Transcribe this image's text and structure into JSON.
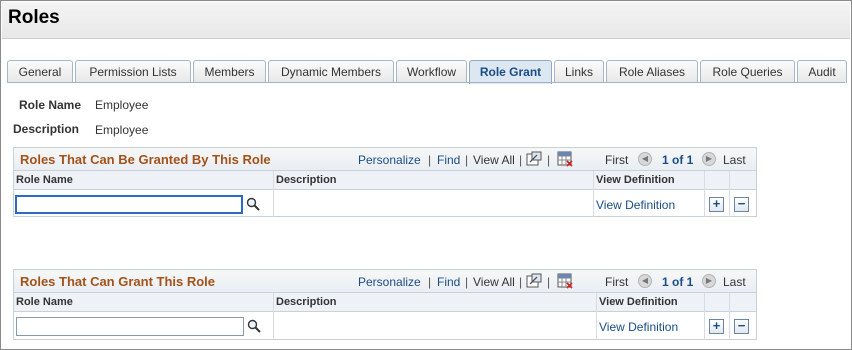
{
  "page": {
    "title": "Roles"
  },
  "tabs": [
    {
      "label": "General",
      "active": false
    },
    {
      "label": "Permission Lists",
      "active": false
    },
    {
      "label": "Members",
      "active": false
    },
    {
      "label": "Dynamic Members",
      "active": false
    },
    {
      "label": "Workflow",
      "active": false
    },
    {
      "label": "Role Grant",
      "active": true
    },
    {
      "label": "Links",
      "active": false
    },
    {
      "label": "Role Aliases",
      "active": false
    },
    {
      "label": "Role Queries",
      "active": false
    },
    {
      "label": "Audit",
      "active": false
    }
  ],
  "fields": {
    "role_name_label": "Role Name",
    "role_name_value": "Employee",
    "description_label": "Description",
    "description_value": "Employee"
  },
  "grids": [
    {
      "title": "Roles That Can Be Granted By This Role",
      "personalize": "Personalize",
      "sep": "|",
      "find": "Find",
      "view_all": "View All",
      "first": "First",
      "counter": "1 of 1",
      "last": "Last",
      "columns": {
        "role_name": "Role Name",
        "description": "Description",
        "view_definition": "View Definition"
      },
      "row": {
        "role_name": "",
        "description": "",
        "view_definition_link": "View Definition",
        "add": "+",
        "delete": "−"
      }
    },
    {
      "title": "Roles That Can Grant This Role",
      "personalize": "Personalize",
      "sep": "|",
      "find": "Find",
      "view_all": "View All",
      "first": "First",
      "counter": "1 of 1",
      "last": "Last",
      "columns": {
        "role_name": "Role Name",
        "description": "Description",
        "view_definition": "View Definition"
      },
      "row": {
        "role_name": "",
        "description": "",
        "view_definition_link": "View Definition",
        "add": "+",
        "delete": "−"
      }
    }
  ],
  "colors": {
    "grid_title": "#a3521a",
    "link": "#1a4d85",
    "focus": "#2a6bc4"
  },
  "icons": [
    "zoom-icon",
    "download-to-excel-icon",
    "prev-arrow-icon",
    "next-arrow-icon",
    "lookup-icon",
    "add-row-icon",
    "delete-row-icon"
  ]
}
